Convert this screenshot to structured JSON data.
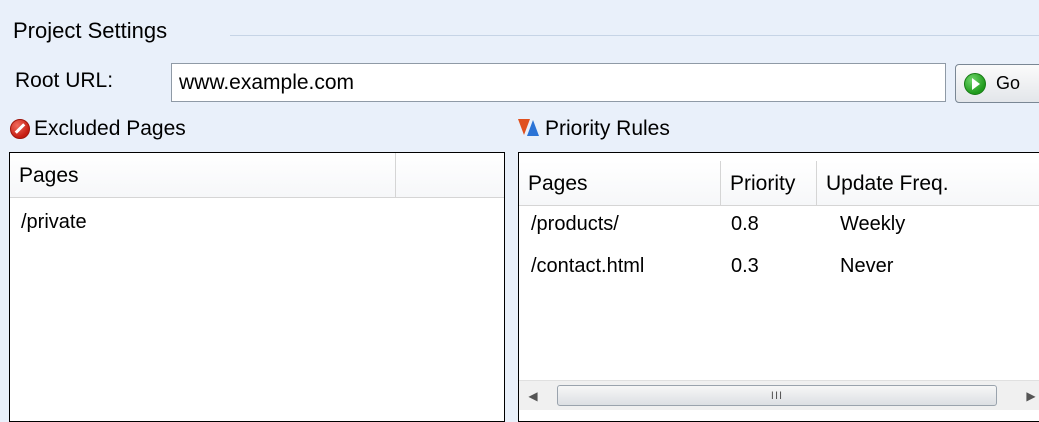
{
  "section": {
    "title": "Project Settings"
  },
  "root_url": {
    "label": "Root URL:",
    "value": "www.example.com",
    "go_label": "Go"
  },
  "excluded": {
    "title": "Excluded Pages",
    "icon": "no-entry-icon",
    "column": "Pages",
    "rows": [
      "/private"
    ]
  },
  "priority": {
    "title": "Priority Rules",
    "icon": "priority-arrows-icon",
    "columns": [
      "Pages",
      "Priority",
      "Update Freq."
    ],
    "rows": [
      {
        "page": "/products/",
        "priority": "0.8",
        "freq": "Weekly"
      },
      {
        "page": "/contact.html",
        "priority": "0.3",
        "freq": "Never"
      }
    ]
  },
  "scrollbar": {
    "grip": "III",
    "left_arrow": "◀",
    "right_arrow": "▶"
  },
  "colors": {
    "background": "#e9f0fa",
    "go_green": "#1f9a1c",
    "no_entry_red": "#c61d12",
    "up_blue": "#2a73d6",
    "down_orange": "#e0501e"
  }
}
